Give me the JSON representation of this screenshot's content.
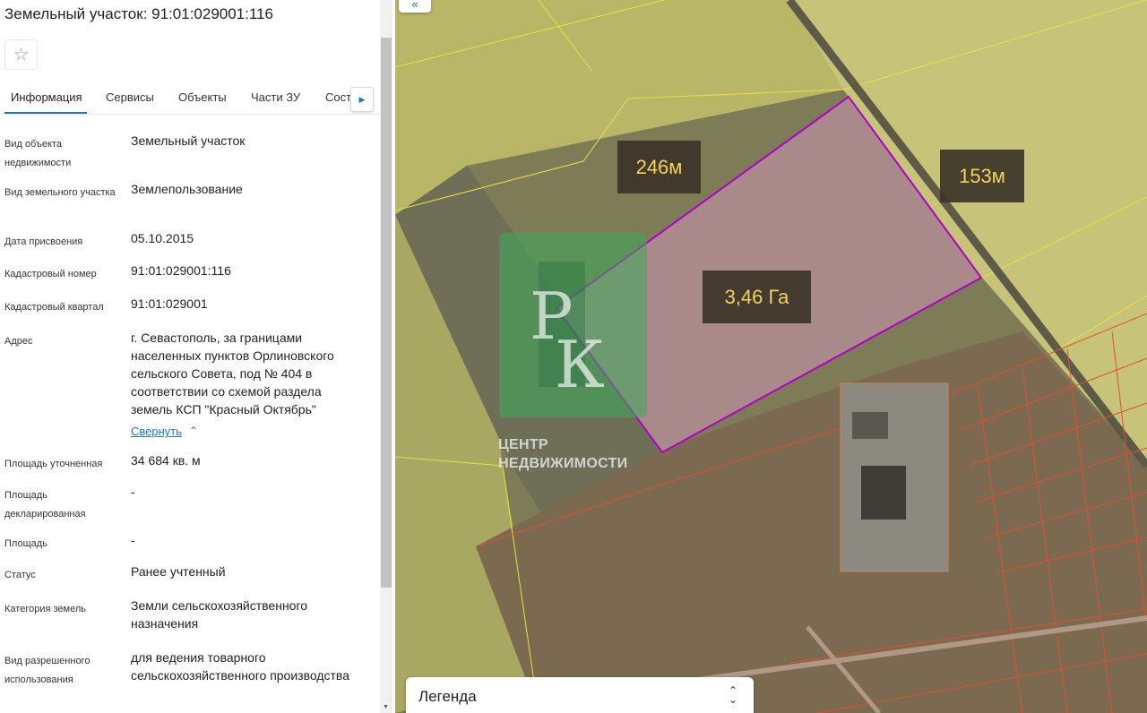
{
  "panel": {
    "title": "Земельный участок: 91:01:029001:116",
    "favorite_icon": "star-icon",
    "tabs": [
      "Информация",
      "Сервисы",
      "Объекты",
      "Части ЗУ",
      "Сост"
    ],
    "active_tab": "Информация",
    "fields": [
      {
        "label": "Вид объекта недвижимости",
        "value": "Земельный участок"
      },
      {
        "label": "Вид земельного участка",
        "value": "Землепользование"
      },
      {
        "label": "Дата присвоения",
        "value": "05.10.2015"
      },
      {
        "label": "Кадастровый номер",
        "value": "91:01:029001:116"
      },
      {
        "label": "Кадастровый квартал",
        "value": "91:01:029001"
      },
      {
        "label": "Адрес",
        "value": "г. Севастополь, за границами населенных пунктов Орлиновского сельского Совета, под № 404 в соответствии со схемой раздела земель КСП \"Красный Октябрь\""
      },
      {
        "label": "Площадь уточненная",
        "value": "34 684 кв. м"
      },
      {
        "label": "Площадь декларированная",
        "value": "-"
      },
      {
        "label": "Площадь",
        "value": "-"
      },
      {
        "label": "Статус",
        "value": "Ранее учтенный"
      },
      {
        "label": "Категория земель",
        "value": "Земли сельскохозяйственного назначения"
      },
      {
        "label": "Вид разрешенного использования",
        "value": "для ведения товарного сельскохозяйственного производства"
      }
    ],
    "collapse_link": "Свернуть"
  },
  "map": {
    "collapse_button": "«",
    "labels": {
      "side_a": "246м",
      "side_b": "153м",
      "area": "3,46 Га"
    },
    "logo": {
      "monogram": "РК",
      "line1": "ЦЕНТР",
      "line2": "НЕДВИЖИМОСТИ"
    },
    "legend_title": "Легенда",
    "colors": {
      "parcel_outline": "#b000c8",
      "neighbor_outline": "#e8e040",
      "lot_outline": "#e05030",
      "label_text": "#f3d25a"
    }
  }
}
